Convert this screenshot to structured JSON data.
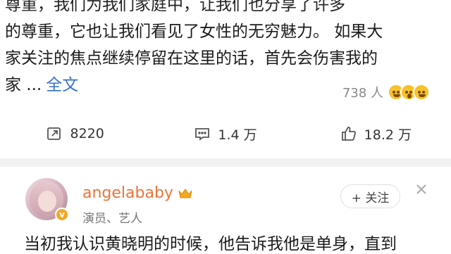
{
  "post": {
    "lines": [
      "的尊重，它也让我们看见了女性的无穷魅力。 如果大",
      "家关注的焦点继续停留在这里的话，首先会伤害我的",
      "家 ..."
    ],
    "more_label": "全文",
    "partial_top_line": "尊重，我们为我们家庭中，让我们也分享了许多"
  },
  "reactions": {
    "count": "738 人",
    "emojis": [
      "grin-emoji",
      "surprised-emoji",
      "laugh-emoji"
    ]
  },
  "actions": {
    "repost": {
      "icon": "repost-icon",
      "count": "8220"
    },
    "comment": {
      "icon": "comment-icon",
      "count": "1.4 万"
    },
    "like": {
      "icon": "like-icon",
      "count": "18.2 万"
    }
  },
  "profile": {
    "username": "angelababy",
    "title": "演员、艺人",
    "follow_label": "+ 关注",
    "badge_color": "#f5a623",
    "name_color": "#e8743b"
  },
  "comment": {
    "text": "当初我认识黄晓明的时候，他告诉我他是单身，直到"
  }
}
